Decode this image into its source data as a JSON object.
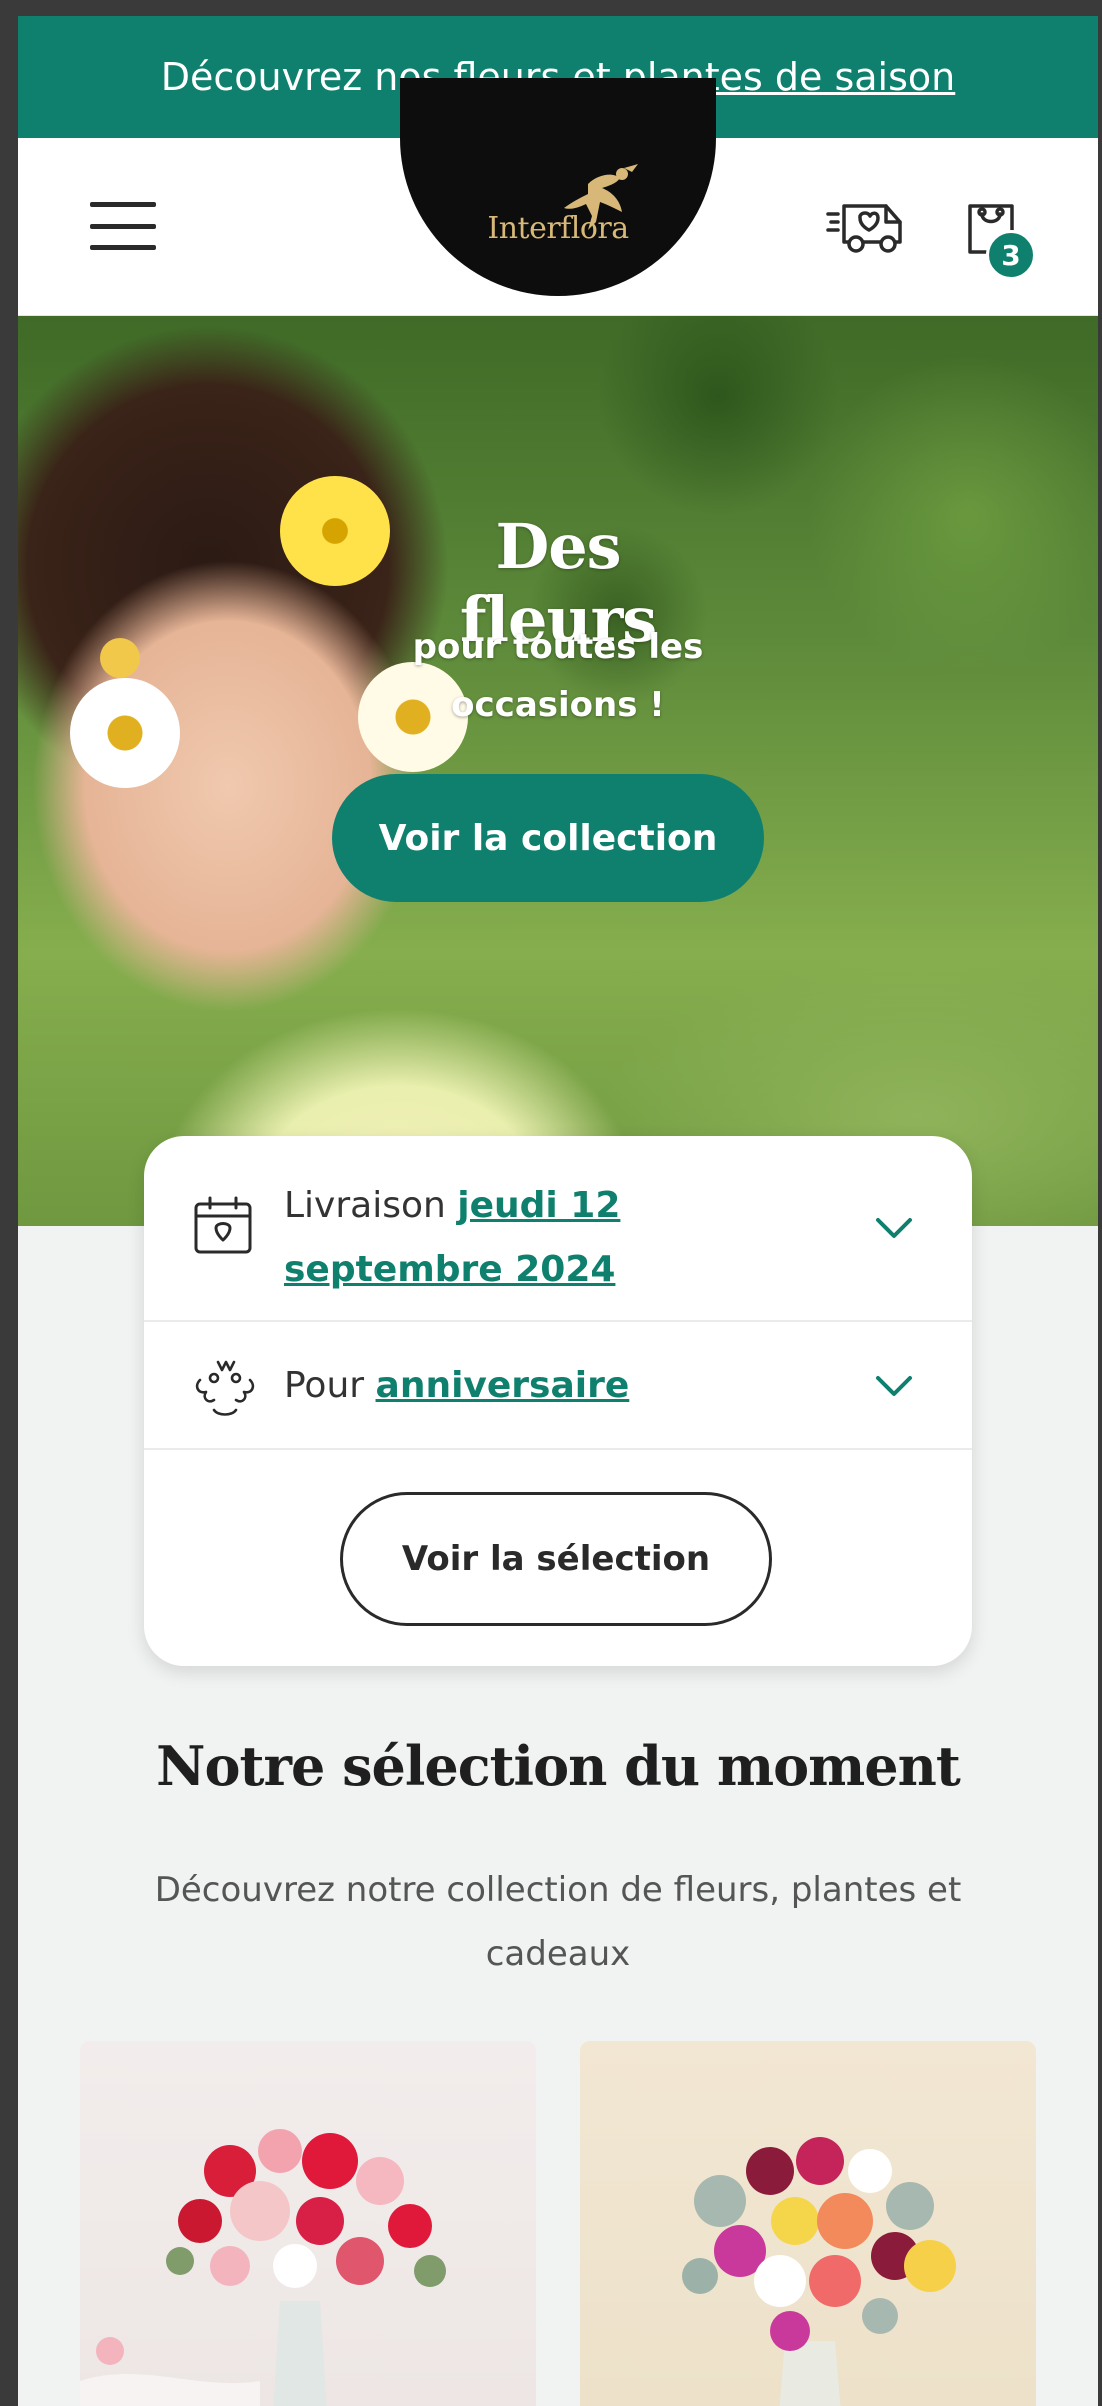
{
  "promo": {
    "text": "Découvrez nos",
    "link": "fleurs et plantes de saison"
  },
  "header": {
    "logo": "Interflora",
    "cart_count": "3"
  },
  "hero": {
    "title": "Des fleurs",
    "subtitle_line1": "pour toutes les",
    "subtitle_line2": "occasions !",
    "cta": "Voir la collection"
  },
  "filters": {
    "delivery_label": "Livraison",
    "delivery_value": "jeudi 12 septembre 2024",
    "occasion_label": "Pour",
    "occasion_value": "anniversaire",
    "submit": "Voir la sélection"
  },
  "selection": {
    "title": "Notre sélection du moment",
    "subtitle": "Découvrez notre collection de fleurs, plantes et cadeaux"
  },
  "colors": {
    "brand_green": "#0f806e",
    "logo_gold": "#d7b878"
  }
}
